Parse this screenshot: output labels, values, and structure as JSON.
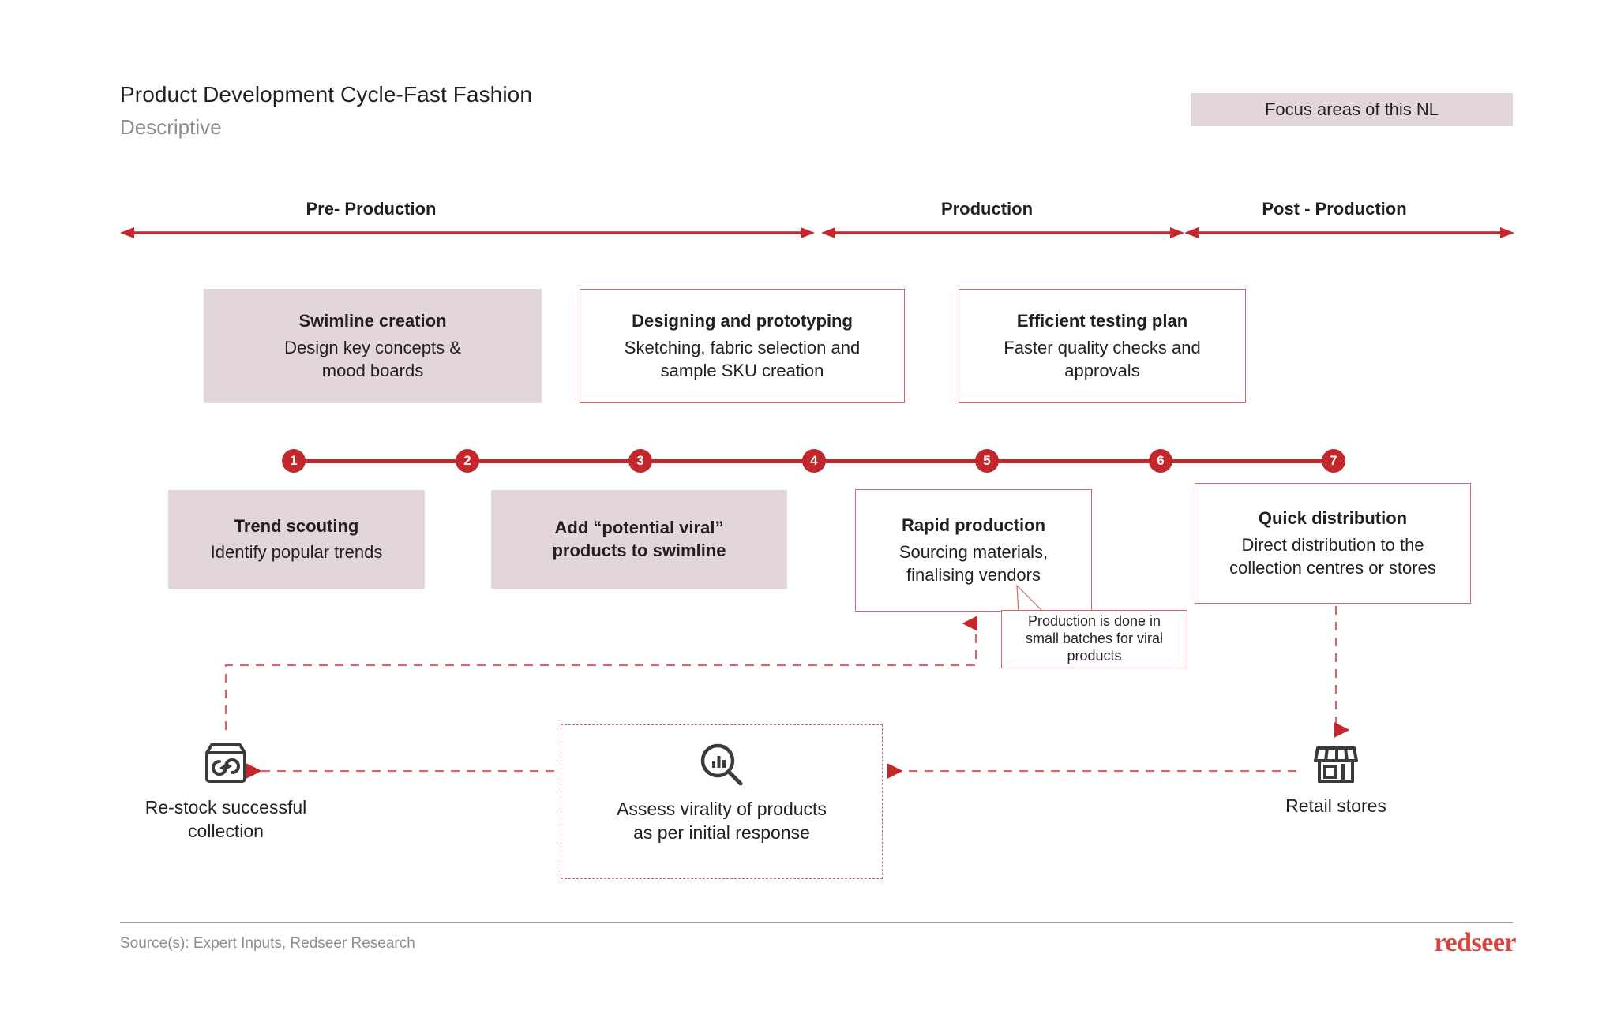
{
  "header": {
    "title": "Product Development Cycle-Fast Fashion",
    "subtitle": "Descriptive",
    "focus_banner": "Focus areas of this NL"
  },
  "phases": [
    {
      "label": "Pre- Production"
    },
    {
      "label": "Production"
    },
    {
      "label": "Post - Production"
    }
  ],
  "top_boxes": [
    {
      "title": "Swimline creation",
      "desc": "Design key concepts &\nmood boards",
      "style": "filled"
    },
    {
      "title": "Designing and prototyping",
      "desc": "Sketching, fabric selection and\nsample SKU creation",
      "style": "outlined"
    },
    {
      "title": "Efficient testing plan",
      "desc": "Faster quality checks and\napprovals",
      "style": "outlined"
    }
  ],
  "steps": [
    {
      "number": "1"
    },
    {
      "number": "2"
    },
    {
      "number": "3"
    },
    {
      "number": "4"
    },
    {
      "number": "5"
    },
    {
      "number": "6"
    },
    {
      "number": "7"
    }
  ],
  "bottom_boxes": [
    {
      "title": "Trend scouting",
      "desc": "Identify popular trends",
      "style": "filled"
    },
    {
      "title": "Add “potential viral”\nproducts to swimline",
      "desc": "",
      "style": "filled"
    },
    {
      "title": "Rapid production",
      "desc": "Sourcing materials,\nfinalising vendors",
      "style": "outlined"
    },
    {
      "title": "Quick distribution",
      "desc": "Direct distribution to the\ncollection centres or stores",
      "style": "outlined"
    }
  ],
  "callout": {
    "text": "Production is done in\nsmall batches for viral\nproducts"
  },
  "loop_items": [
    {
      "icon": "restock-box-icon",
      "label": "Re-stock successful\ncollection"
    },
    {
      "icon": "analytics-magnifier-icon",
      "label": "Assess virality of products\nas per initial response"
    },
    {
      "icon": "storefront-icon",
      "label": "Retail stores"
    }
  ],
  "footer": {
    "source": "Source(s): Expert Inputs, Redseer Research",
    "brand": "redseer"
  },
  "colors": {
    "accent_red": "#c3272b",
    "line_pink": "#d9656a",
    "fill_mauve": "#e3d6da",
    "text_dark": "#231f20",
    "text_muted": "#8d8d8d",
    "brand_red": "#d6453f"
  }
}
